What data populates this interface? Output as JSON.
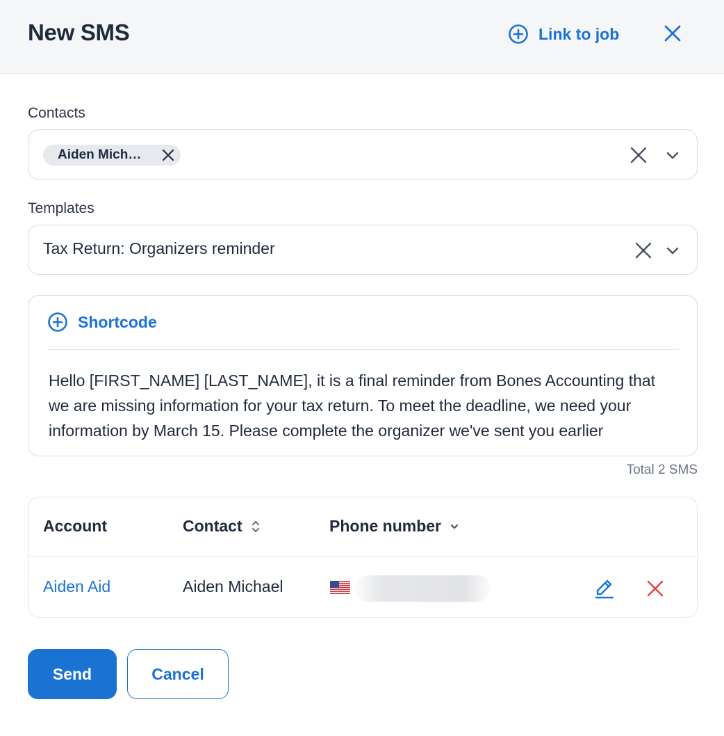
{
  "header": {
    "title": "New SMS",
    "link_to_job_label": "Link to job",
    "link_icon": "plus-circle-icon",
    "close_icon": "close-icon"
  },
  "contacts": {
    "label": "Contacts",
    "chips": [
      "Aiden Mich…"
    ]
  },
  "templates": {
    "label": "Templates",
    "selected": "Tax Return: Organizers reminder"
  },
  "message": {
    "shortcode_label": "Shortcode",
    "text": "Hello [FIRST_NAME] [LAST_NAME], it is a final reminder from Bones Accounting that we are missing information for your tax return. To meet the deadline, we need your information by March 15. Please complete the organizer we've sent you earlier",
    "total": "Total 2 SMS"
  },
  "table": {
    "columns": [
      "Account",
      "Contact",
      "Phone number"
    ],
    "rows": [
      {
        "account": "Aiden Aid",
        "contact": "Aiden Michael",
        "phone_flag": "us-flag-icon"
      }
    ]
  },
  "actions": {
    "send_label": "Send",
    "cancel_label": "Cancel"
  },
  "colors": {
    "accent": "#1a73d2",
    "danger": "#e2474b",
    "text": "#1f2a3c",
    "header_bg": "#f5f6f8"
  }
}
